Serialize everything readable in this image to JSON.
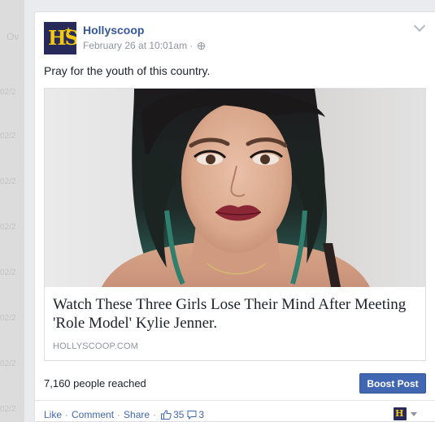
{
  "sidebar": {
    "rows": [
      "Ov",
      "02/2",
      "02/2",
      "02/2",
      "02/2",
      "02/2",
      "02/2",
      "02/2",
      "02/2"
    ]
  },
  "post": {
    "page_name": "Hollyscoop",
    "timestamp": "February 26 at 10:01am",
    "meta_separator": "·",
    "text": "Pray for the youth of this country.",
    "link": {
      "title": "Watch These Three Girls Lose Their Mind After Meeting 'Role Model' Kylie Jenner.",
      "domain": "HOLLYSCOOP.COM"
    },
    "reach": "7,160 people reached",
    "boost_label": "Boost Post",
    "actions": {
      "like": "Like",
      "comment": "Comment",
      "share": "Share",
      "separator": "·",
      "like_count": "35",
      "comment_count": "3"
    }
  },
  "icons": {
    "logo": "hollyscoop-logo-icon",
    "globe": "globe-icon",
    "chevron": "chevron-down-icon",
    "like": "thumbs-up-icon",
    "comment": "comment-bubble-icon"
  },
  "colors": {
    "link_blue": "#365899",
    "button_blue": "#4267b2",
    "logo_bg": "#26295a",
    "logo_fg": "#f2c811"
  }
}
